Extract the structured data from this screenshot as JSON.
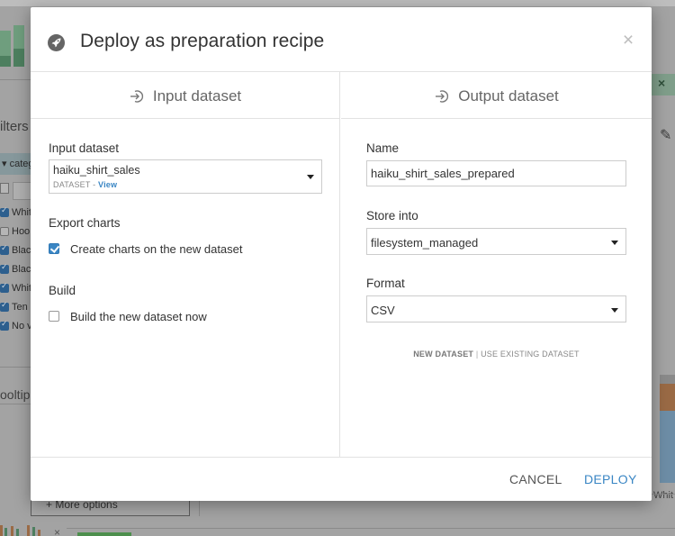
{
  "dialog": {
    "title": "Deploy as preparation recipe",
    "close_symbol": "×"
  },
  "input_column": {
    "heading": "Input dataset",
    "input_dataset": {
      "label": "Input dataset",
      "selected": "haiku_shirt_sales",
      "type_text": "DATASET",
      "separator": " - ",
      "view_link": "View"
    },
    "export_charts": {
      "label": "Export charts",
      "checkbox_label": "Create charts on the new dataset",
      "checked": true
    },
    "build": {
      "label": "Build",
      "checkbox_label": "Build the new dataset now",
      "checked": false
    }
  },
  "output_column": {
    "heading": "Output dataset",
    "name": {
      "label": "Name",
      "value": "haiku_shirt_sales_prepared"
    },
    "store_into": {
      "label": "Store into",
      "selected": "filesystem_managed"
    },
    "format": {
      "label": "Format",
      "selected": "CSV"
    },
    "dataset_mode": {
      "new_label": "NEW DATASET",
      "separator": "|",
      "existing_label": "USE EXISTING DATASET"
    }
  },
  "footer": {
    "cancel_label": "CANCEL",
    "deploy_label": "DEPLOY"
  },
  "background": {
    "filters_label": "ilters",
    "category_label": "categ",
    "tooltip_label": "ooltip",
    "more_options_label": "+ More options",
    "right_label": "Whit",
    "filter_rows": [
      {
        "text": "Whit",
        "checked": true
      },
      {
        "text": "Hoo",
        "checked": false
      },
      {
        "text": "Blac",
        "checked": true
      },
      {
        "text": "Blac",
        "checked": true
      },
      {
        "text": "Whit",
        "checked": true
      },
      {
        "text": "Ten",
        "checked": true
      },
      {
        "text": "No v",
        "checked": true
      }
    ]
  },
  "colors": {
    "accent": "#3a86c4",
    "checkbox_checked": "#3a86c4",
    "icon_grey": "#656565"
  }
}
